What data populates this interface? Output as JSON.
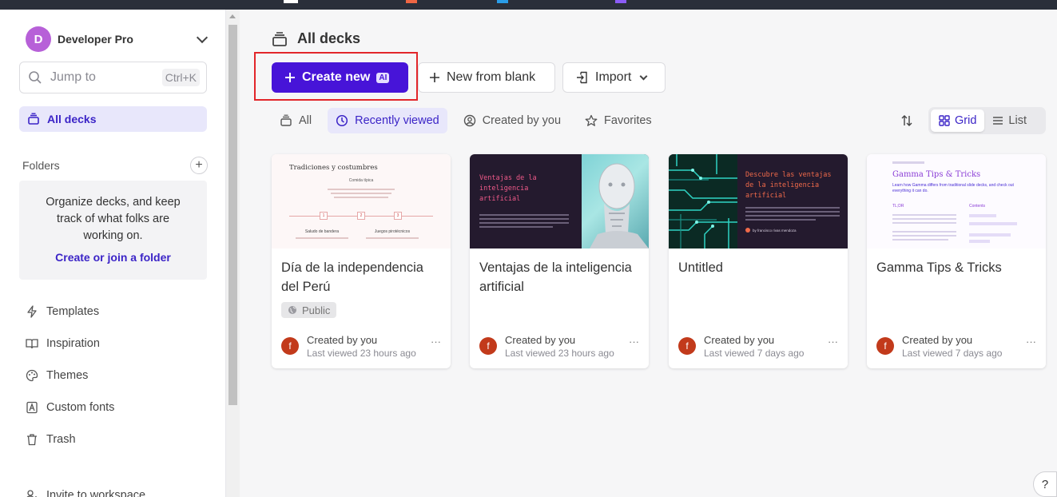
{
  "workspace": {
    "initial": "D",
    "name": "Developer Pro"
  },
  "search": {
    "placeholder": "Jump to",
    "shortcut": "Ctrl+K"
  },
  "sidebar": {
    "all_decks": "All decks",
    "folders_label": "Folders",
    "folders_empty_text": "Organize decks, and keep track of what folks are working on.",
    "folders_link": "Create or join a folder",
    "items": [
      {
        "label": "Templates",
        "icon": "bolt-icon"
      },
      {
        "label": "Inspiration",
        "icon": "book-icon"
      },
      {
        "label": "Themes",
        "icon": "palette-icon"
      },
      {
        "label": "Custom fonts",
        "icon": "font-icon"
      },
      {
        "label": "Trash",
        "icon": "trash-icon"
      },
      {
        "label": "Invite to workspace",
        "icon": "add-user-icon"
      }
    ]
  },
  "main": {
    "title": "All decks",
    "create_new": "Create new",
    "ai_badge": "AI",
    "new_from_blank": "New from blank",
    "import": "Import",
    "filters": [
      "All",
      "Recently viewed",
      "Created by you",
      "Favorites"
    ],
    "active_filter": "Recently viewed",
    "view": {
      "grid": "Grid",
      "list": "List",
      "active": "Grid"
    }
  },
  "cards": [
    {
      "title": "Día de la independencia del Perú",
      "badge": "Public",
      "avatar": "f",
      "created": "Created by you",
      "viewed": "Last viewed 23 hours ago",
      "thumb": {
        "heading": "Tradiciones y costumbres",
        "subheading": "Comida típica",
        "steps": [
          "1",
          "2",
          "3"
        ],
        "col1": "Saludo de bandera",
        "col2": "Juegos pirotécnicos"
      }
    },
    {
      "title": "Ventajas de la inteligencia artificial",
      "avatar": "f",
      "created": "Created by you",
      "viewed": "Last viewed 23 hours ago",
      "thumb": {
        "heading": "Ventajas de la inteligencia artificial"
      }
    },
    {
      "title": "Untitled",
      "avatar": "f",
      "created": "Created by you",
      "viewed": "Last viewed 7 days ago",
      "thumb": {
        "heading": "Descubre las ventajas de la inteligencia artificial",
        "author": "by francisco rivas mendoza"
      }
    },
    {
      "title": "Gamma Tips & Tricks",
      "avatar": "f",
      "created": "Created by you",
      "viewed": "Last viewed 7 days ago",
      "thumb": {
        "heading": "Gamma Tips & Tricks",
        "subheading": "Learn how Gamma differs from traditional slide decks, and check out everything it can do.",
        "col1": "TL;DR",
        "col2": "Contents"
      }
    }
  ],
  "colors": {
    "accent": "#4714d8",
    "accent_soft": "#e8e7fb",
    "highlight_box": "#e2262a",
    "avatar_workspace": "#b760d8",
    "avatar_user": "#c23a1b"
  },
  "help": "?"
}
